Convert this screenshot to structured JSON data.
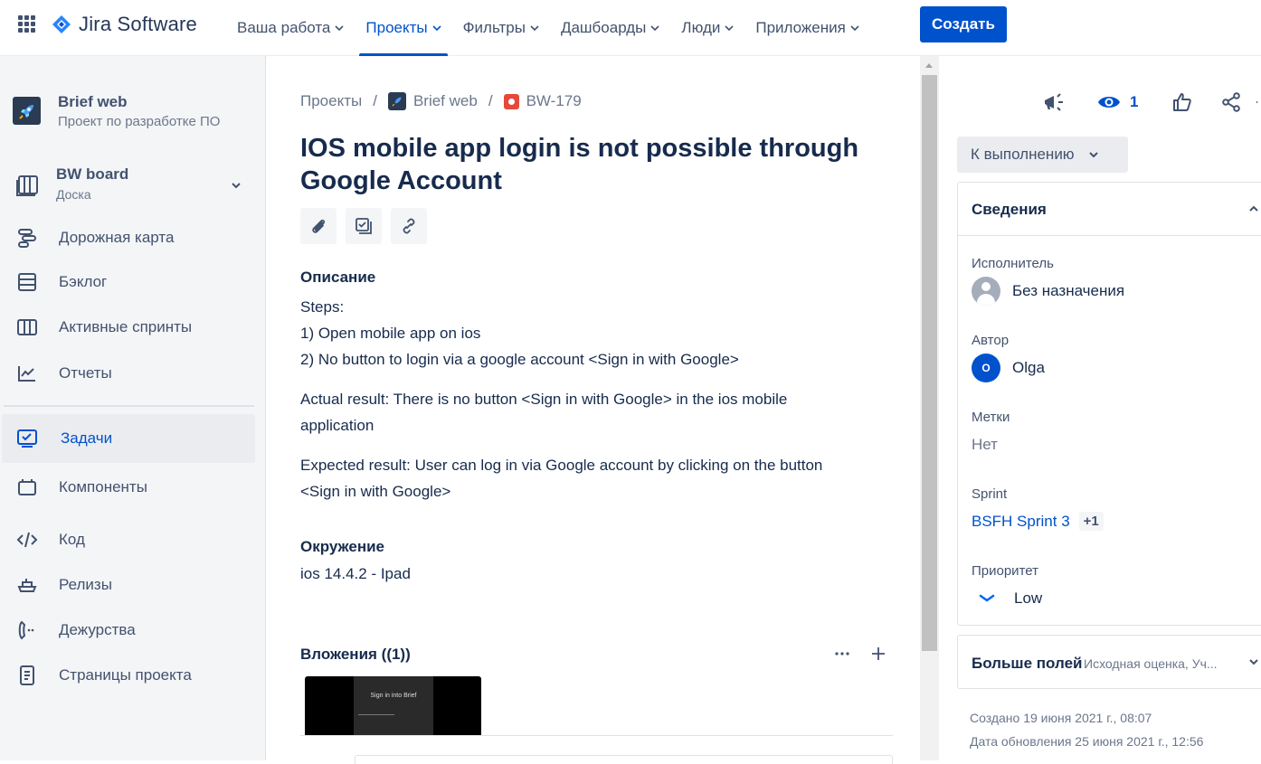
{
  "topbar": {
    "product": "Jira Software",
    "nav": [
      {
        "label": "Ваша работа",
        "active": false
      },
      {
        "label": "Проекты",
        "active": true
      },
      {
        "label": "Фильтры",
        "active": false
      },
      {
        "label": "Дашбоарды",
        "active": false
      },
      {
        "label": "Люди",
        "active": false
      },
      {
        "label": "Приложения",
        "active": false
      }
    ],
    "create_label": "Создать",
    "accent": "#0052cc"
  },
  "sidebar": {
    "project_name": "Brief web",
    "project_type": "Проект по разработке ПО",
    "board_name": "BW board",
    "board_type": "Доска",
    "items": [
      {
        "label": "Дорожная карта",
        "icon": "roadmap-icon"
      },
      {
        "label": "Бэклог",
        "icon": "backlog-icon"
      },
      {
        "label": "Активные спринты",
        "icon": "sprints-icon"
      },
      {
        "label": "Отчеты",
        "icon": "reports-icon"
      },
      {
        "label": "Задачи",
        "icon": "issues-icon",
        "active": true
      },
      {
        "label": "Компоненты",
        "icon": "components-icon"
      },
      {
        "label": "Код",
        "icon": "code-icon"
      },
      {
        "label": "Релизы",
        "icon": "releases-icon"
      },
      {
        "label": "Дежурства",
        "icon": "on-call-icon"
      },
      {
        "label": "Страницы проекта",
        "icon": "pages-icon"
      }
    ]
  },
  "issue": {
    "breadcrumbs": [
      "Проекты",
      "Brief web",
      "BW-179"
    ],
    "title": "IOS mobile app login is not possible through Google Account",
    "description_heading": "Описание",
    "description": [
      "Steps:",
      "1) Open mobile app on ios",
      "2) No button to login via a google account <Sign in with Google>",
      "Actual result: There is no button <Sign in with Google> in the ios mobile application",
      "Expected result: User can log in via Google account by clicking on the button <Sign in with Google>"
    ],
    "environment_heading": "Окружение",
    "environment": "ios 14.4.2 - Ipad",
    "attachments_heading": "Вложения ((1))",
    "attachment_thumb_text": "Sign in into Brief"
  },
  "details": {
    "watch_count": "1",
    "status": "К выполнению",
    "panel_title": "Сведения",
    "assignee_label": "Исполнитель",
    "assignee": "Без назначения",
    "reporter_label": "Автор",
    "reporter": "Olga",
    "reporter_initial": "O",
    "labels_label": "Метки",
    "labels": "Нет",
    "sprint_label": "Sprint",
    "sprint": "BSFH Sprint 3",
    "sprint_extra": "+1",
    "priority_label": "Приоритет",
    "priority": "Low",
    "more_fields": "Больше полей",
    "more_fields_hint": "Исходная оценка, Уч...",
    "created": "Создано 19 июня 2021 г., 08:07",
    "updated": "Дата обновления 25 июня 2021 г., 12:56"
  }
}
